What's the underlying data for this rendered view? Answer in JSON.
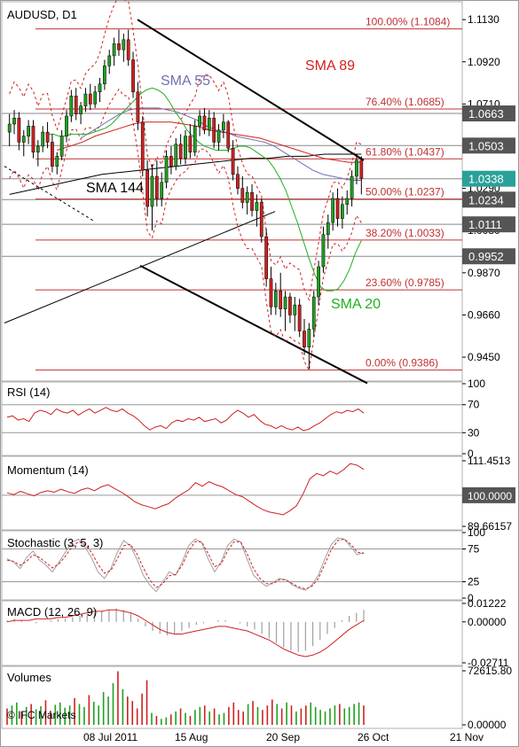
{
  "chart_data": [
    {
      "type": "candlestick",
      "title": "AUDUSD, D1",
      "ylim": [
        0.934,
        1.121
      ],
      "y_ticks": [
        "1.1130",
        "1.0920",
        "1.0710",
        "1.0290",
        "1.0080",
        "0.9870",
        "0.9660",
        "0.9450"
      ],
      "price_tags": [
        {
          "label": "1.0663",
          "value": 1.0663,
          "color": "#555555"
        },
        {
          "label": "1.0503",
          "value": 1.0503,
          "color": "#555555"
        },
        {
          "label": "1.0338",
          "value": 1.0338,
          "color": "#2aa198"
        },
        {
          "label": "1.0234",
          "value": 1.0234,
          "color": "#555555"
        },
        {
          "label": "1.0111",
          "value": 1.0111,
          "color": "#555555"
        },
        {
          "label": "0.9952",
          "value": 0.9952,
          "color": "#555555"
        }
      ],
      "fibonacci": [
        {
          "label": "100.00% (1.1084)",
          "value": 1.1084
        },
        {
          "label": "76.40% (1.0685)",
          "value": 1.0685
        },
        {
          "label": "61.80% (1.0437)",
          "value": 1.0437
        },
        {
          "label": "50.00% (1.0237)",
          "value": 1.0237
        },
        {
          "label": "38.20% (1.0033)",
          "value": 1.0033
        },
        {
          "label": "23.60% (0.9785)",
          "value": 0.9785
        },
        {
          "label": "0.00% (0.9386)",
          "value": 0.9386
        }
      ],
      "annotations": [
        {
          "text": "SMA 89",
          "color": "#d42020"
        },
        {
          "text": "SMA 55",
          "color": "#7070b0"
        },
        {
          "text": "SMA 144",
          "color": "#000000"
        },
        {
          "text": "SMA 20",
          "color": "#20b020"
        }
      ],
      "colors": {
        "bull": "#20a020",
        "bear": "#d02020",
        "fib": "#c03030"
      },
      "candles": [
        [
          1.057,
          1.066,
          1.05,
          1.061
        ],
        [
          1.061,
          1.068,
          1.056,
          1.064
        ],
        [
          1.064,
          1.067,
          1.048,
          1.052
        ],
        [
          1.052,
          1.058,
          1.045,
          1.055
        ],
        [
          1.055,
          1.063,
          1.051,
          1.06
        ],
        [
          1.06,
          1.063,
          1.044,
          1.047
        ],
        [
          1.047,
          1.053,
          1.04,
          1.05
        ],
        [
          1.05,
          1.06,
          1.047,
          1.057
        ],
        [
          1.057,
          1.062,
          1.049,
          1.052
        ],
        [
          1.052,
          1.056,
          1.037,
          1.04
        ],
        [
          1.04,
          1.047,
          1.036,
          1.045
        ],
        [
          1.045,
          1.058,
          1.043,
          1.055
        ],
        [
          1.055,
          1.068,
          1.052,
          1.065
        ],
        [
          1.065,
          1.078,
          1.062,
          1.075
        ],
        [
          1.075,
          1.079,
          1.063,
          1.066
        ],
        [
          1.066,
          1.072,
          1.061,
          1.07
        ],
        [
          1.07,
          1.079,
          1.067,
          1.076
        ],
        [
          1.076,
          1.081,
          1.068,
          1.071
        ],
        [
          1.071,
          1.08,
          1.069,
          1.077
        ],
        [
          1.077,
          1.084,
          1.072,
          1.081
        ],
        [
          1.081,
          1.093,
          1.078,
          1.09
        ],
        [
          1.09,
          1.098,
          1.086,
          1.095
        ],
        [
          1.095,
          1.104,
          1.09,
          1.101
        ],
        [
          1.101,
          1.108,
          1.095,
          1.098
        ],
        [
          1.098,
          1.106,
          1.092,
          1.103
        ],
        [
          1.103,
          1.108,
          1.09,
          1.093
        ],
        [
          1.093,
          1.097,
          1.074,
          1.077
        ],
        [
          1.077,
          1.082,
          1.058,
          1.062
        ],
        [
          1.062,
          1.065,
          1.035,
          1.038
        ],
        [
          1.038,
          1.043,
          1.015,
          1.02
        ],
        [
          1.02,
          1.041,
          1.008,
          1.035
        ],
        [
          1.035,
          1.043,
          1.02,
          1.024
        ],
        [
          1.024,
          1.037,
          1.02,
          1.032
        ],
        [
          1.032,
          1.048,
          1.029,
          1.045
        ],
        [
          1.045,
          1.05,
          1.036,
          1.04
        ],
        [
          1.04,
          1.054,
          1.038,
          1.051
        ],
        [
          1.051,
          1.056,
          1.041,
          1.044
        ],
        [
          1.044,
          1.058,
          1.041,
          1.055
        ],
        [
          1.055,
          1.061,
          1.044,
          1.047
        ],
        [
          1.047,
          1.063,
          1.045,
          1.06
        ],
        [
          1.06,
          1.068,
          1.055,
          1.065
        ],
        [
          1.065,
          1.069,
          1.056,
          1.058
        ],
        [
          1.058,
          1.068,
          1.055,
          1.064
        ],
        [
          1.064,
          1.067,
          1.049,
          1.052
        ],
        [
          1.052,
          1.061,
          1.048,
          1.058
        ],
        [
          1.058,
          1.066,
          1.054,
          1.062
        ],
        [
          1.062,
          1.063,
          1.047,
          1.049
        ],
        [
          1.049,
          1.053,
          1.033,
          1.036
        ],
        [
          1.036,
          1.04,
          1.026,
          1.029
        ],
        [
          1.029,
          1.035,
          1.019,
          1.022
        ],
        [
          1.022,
          1.03,
          1.016,
          1.027
        ],
        [
          1.027,
          1.031,
          1.015,
          1.018
        ],
        [
          1.018,
          1.026,
          1.01,
          1.022
        ],
        [
          1.022,
          1.024,
          1.002,
          1.005
        ],
        [
          1.005,
          1.009,
          0.98,
          0.984
        ],
        [
          0.984,
          0.99,
          0.966,
          0.97
        ],
        [
          0.97,
          0.982,
          0.966,
          0.978
        ],
        [
          0.978,
          0.987,
          0.965,
          0.969
        ],
        [
          0.969,
          0.978,
          0.958,
          0.975
        ],
        [
          0.975,
          0.977,
          0.962,
          0.966
        ],
        [
          0.966,
          0.975,
          0.958,
          0.971
        ],
        [
          0.971,
          0.974,
          0.955,
          0.958
        ],
        [
          0.958,
          0.964,
          0.946,
          0.95
        ],
        [
          0.95,
          0.962,
          0.939,
          0.959
        ],
        [
          0.959,
          0.978,
          0.955,
          0.975
        ],
        [
          0.975,
          0.993,
          0.971,
          0.99
        ],
        [
          0.99,
          1.01,
          0.987,
          1.006
        ],
        [
          1.006,
          1.016,
          0.999,
          1.012
        ],
        [
          1.012,
          1.027,
          1.008,
          1.024
        ],
        [
          1.024,
          1.029,
          1.01,
          1.014
        ],
        [
          1.014,
          1.025,
          1.009,
          1.021
        ],
        [
          1.021,
          1.028,
          1.016,
          1.024
        ],
        [
          1.024,
          1.038,
          1.02,
          1.035
        ],
        [
          1.035,
          1.046,
          1.031,
          1.043
        ],
        [
          1.043,
          1.045,
          1.026,
          1.034
        ]
      ],
      "sma20": [
        1.056,
        1.056,
        1.055,
        1.055,
        1.056,
        1.056,
        1.056,
        1.056,
        1.057,
        1.058,
        1.059,
        1.061,
        1.064,
        1.067,
        1.07,
        1.073,
        1.076,
        1.078,
        1.079,
        1.078,
        1.076,
        1.072,
        1.067,
        1.063,
        1.058,
        1.055,
        1.052,
        1.05,
        1.049,
        1.048,
        1.048,
        1.048,
        1.049,
        1.05,
        1.05,
        1.049,
        1.047,
        1.045,
        1.043,
        1.039,
        1.034,
        1.028,
        1.02,
        1.012,
        1.003,
        0.994,
        0.986,
        0.98,
        0.978,
        0.978,
        0.979,
        0.983,
        0.989,
        0.997,
        1.003
      ],
      "sma55": [
        1.054,
        1.057,
        1.06,
        1.063,
        1.066,
        1.068,
        1.069,
        1.069,
        1.069,
        1.068,
        1.067,
        1.065,
        1.063,
        1.06,
        1.058,
        1.057,
        1.055,
        1.054,
        1.053,
        1.052,
        1.05,
        1.047,
        1.044,
        1.041,
        1.038,
        1.036,
        1.035,
        1.034,
        1.033,
        1.033
      ],
      "sma89": [
        1.048,
        1.05,
        1.052,
        1.055,
        1.057,
        1.059,
        1.061,
        1.062,
        1.062,
        1.062,
        1.061,
        1.06,
        1.058,
        1.057,
        1.056,
        1.055,
        1.054,
        1.052,
        1.05,
        1.048,
        1.046,
        1.044,
        1.043,
        1.042,
        1.042
      ],
      "sma144": [
        1.026,
        1.028,
        1.03,
        1.032,
        1.034,
        1.036,
        1.037,
        1.038,
        1.039,
        1.04,
        1.041,
        1.042,
        1.043,
        1.044,
        1.044,
        1.045,
        1.045,
        1.046,
        1.046,
        1.046
      ]
    },
    {
      "type": "line",
      "title": "RSI (14)",
      "ylim": [
        0,
        100
      ],
      "y_ticks": [
        "100",
        "70",
        "30",
        "0"
      ],
      "levels": [
        70,
        30
      ],
      "values": [
        52,
        54,
        48,
        50,
        46,
        58,
        62,
        60,
        56,
        64,
        60,
        58,
        62,
        55,
        60,
        64,
        58,
        62,
        66,
        62,
        60,
        64,
        58,
        54,
        48,
        40,
        34,
        38,
        40,
        36,
        44,
        48,
        46,
        50,
        48,
        52,
        46,
        48,
        50,
        44,
        48,
        56,
        62,
        58,
        52,
        56,
        48,
        42,
        40,
        36,
        40,
        36,
        34,
        38,
        33,
        35,
        40,
        44,
        50,
        56,
        60,
        58,
        62,
        60,
        64,
        58
      ]
    },
    {
      "type": "line",
      "title": "Momentum (14)",
      "y_ticks": [
        "111.4513",
        "100.0000",
        "89.66157"
      ],
      "ylim": [
        89.66157,
        111.4513
      ],
      "values": [
        100.8,
        100.2,
        101.3,
        100.5,
        99.8,
        100.9,
        101.5,
        101.0,
        102.0,
        101.2,
        100.6,
        101.8,
        102.4,
        101.5,
        102.8,
        103.5,
        102.2,
        101.0,
        99.5,
        97.8,
        96.8,
        96.2,
        95.5,
        96.4,
        97.2,
        99.0,
        100.5,
        101.8,
        104.2,
        103.0,
        104.5,
        103.5,
        102.8,
        101.5,
        100.2,
        99.5,
        98.0,
        96.5,
        95.2,
        94.4,
        94.0,
        93.5,
        94.8,
        96.5,
        100.5,
        105.5,
        107.2,
        106.5,
        108.0,
        107.0,
        108.5,
        110.5,
        110.0,
        108.6
      ]
    },
    {
      "type": "line",
      "title": "Stochastic (3, 5, 3)",
      "ylim": [
        0,
        100
      ],
      "y_ticks": [
        "100",
        "75",
        "25",
        "0"
      ],
      "levels": [
        75,
        25
      ],
      "series": [
        {
          "values": [
            60,
            55,
            45,
            62,
            72,
            58,
            50,
            40,
            55,
            70,
            85,
            90,
            78,
            62,
            40,
            30,
            45,
            70,
            88,
            80,
            60,
            35,
            20,
            10,
            25,
            40,
            35,
            55,
            80,
            90,
            85,
            60,
            40,
            55,
            80,
            90,
            86,
            60,
            35,
            25,
            18,
            24,
            30,
            28,
            20,
            15,
            12,
            20,
            35,
            60,
            82,
            92,
            90,
            78,
            66,
            70
          ]
        },
        {
          "values": [
            58,
            56,
            50,
            56,
            66,
            62,
            54,
            46,
            52,
            64,
            78,
            86,
            82,
            70,
            52,
            38,
            42,
            60,
            80,
            82,
            68,
            46,
            28,
            16,
            22,
            34,
            36,
            50,
            72,
            86,
            86,
            68,
            48,
            52,
            72,
            86,
            86,
            68,
            45,
            30,
            22,
            22,
            28,
            28,
            22,
            17,
            14,
            18,
            30,
            52,
            74,
            88,
            90,
            82,
            70,
            68
          ]
        }
      ]
    },
    {
      "type": "histogram-line",
      "title": "MACD (12, 26, 9)",
      "y_ticks": [
        "0.01222",
        "0.00000",
        "-0.02711"
      ],
      "ylim": [
        -0.02711,
        0.01222
      ],
      "histogram": [
        0.001,
        0.002,
        0.001,
        0.0,
        -0.001,
        0.0,
        0.001,
        0.002,
        0.002,
        0.003,
        0.004,
        0.005,
        0.006,
        0.007,
        0.008,
        0.009,
        0.008,
        0.006,
        0.002,
        -0.003,
        -0.006,
        -0.008,
        -0.009,
        -0.008,
        -0.006,
        -0.004,
        -0.002,
        -0.001,
        0.0,
        0.001,
        0.001,
        0.0,
        -0.001,
        -0.003,
        -0.005,
        -0.008,
        -0.011,
        -0.014,
        -0.017,
        -0.019,
        -0.02,
        -0.019,
        -0.016,
        -0.012,
        -0.008,
        -0.004,
        0.001,
        0.004,
        0.006,
        0.008
      ],
      "signal": [
        0.0,
        0.001,
        0.001,
        0.001,
        0.002,
        0.002,
        0.002,
        0.003,
        0.003,
        0.004,
        0.005,
        0.006,
        0.007,
        0.007,
        0.008,
        0.008,
        0.007,
        0.006,
        0.004,
        0.001,
        -0.002,
        -0.005,
        -0.007,
        -0.008,
        -0.008,
        -0.007,
        -0.006,
        -0.005,
        -0.004,
        -0.003,
        -0.003,
        -0.004,
        -0.005,
        -0.006,
        -0.008,
        -0.01,
        -0.012,
        -0.015,
        -0.018,
        -0.02,
        -0.022,
        -0.023,
        -0.022,
        -0.02,
        -0.017,
        -0.013,
        -0.009,
        -0.005,
        -0.002,
        0.001
      ]
    },
    {
      "type": "bar",
      "title": "Volumes",
      "y_ticks": [
        "72615.80",
        "0.00000"
      ],
      "ylim": [
        0,
        72615.8
      ],
      "watermark": "© IFC Markets",
      "values": [
        22000,
        26000,
        30000,
        18000,
        24000,
        28000,
        21000,
        25000,
        33000,
        19000,
        27000,
        30000,
        23000,
        26000,
        36000,
        28000,
        24000,
        40000,
        31000,
        26000,
        44000,
        38000,
        56000,
        72000,
        48000,
        38000,
        32000,
        22000,
        42000,
        60000,
        16000,
        12000,
        8000,
        10000,
        14000,
        18000,
        22000,
        16000,
        12000,
        20000,
        24000,
        26000,
        18000,
        22000,
        14000,
        16000,
        24000,
        30000,
        20000,
        18000,
        28000,
        32000,
        24000,
        20000,
        26000,
        34000,
        28000,
        22000,
        30000,
        26000,
        18000,
        22000,
        26000,
        30000,
        24000,
        20000,
        18000,
        22000,
        26000,
        28000,
        22000,
        24000,
        28000,
        30000,
        26000
      ],
      "colors": [
        "#d02020",
        "#20a020",
        "#20a020",
        "#d02020",
        "#20a020",
        "#d02020",
        "#20a020",
        "#20a020",
        "#d02020",
        "#d02020",
        "#20a020",
        "#20a020",
        "#20a020",
        "#20a020",
        "#d02020",
        "#20a020",
        "#20a020",
        "#d02020",
        "#20a020",
        "#20a020",
        "#20a020",
        "#20a020",
        "#20a020",
        "#d02020",
        "#20a020",
        "#d02020",
        "#d02020",
        "#d02020",
        "#d02020",
        "#d02020",
        "#20a020",
        "#d02020",
        "#20a020",
        "#20a020",
        "#d02020",
        "#20a020",
        "#d02020",
        "#20a020",
        "#d02020",
        "#20a020",
        "#20a020",
        "#d02020",
        "#20a020",
        "#d02020",
        "#20a020",
        "#20a020",
        "#d02020",
        "#d02020",
        "#d02020",
        "#d02020",
        "#20a020",
        "#d02020",
        "#20a020",
        "#d02020",
        "#d02020",
        "#d02020",
        "#20a020",
        "#d02020",
        "#20a020",
        "#d02020",
        "#20a020",
        "#d02020",
        "#d02020",
        "#20a020",
        "#20a020",
        "#20a020",
        "#20a020",
        "#20a020",
        "#20a020",
        "#d02020",
        "#20a020",
        "#20a020",
        "#20a020",
        "#20a020",
        "#d02020"
      ]
    }
  ],
  "x_axis": {
    "labels": [
      "08 Jul 2011",
      "15 Aug",
      "20 Sep",
      "26 Oct",
      "21 Nov"
    ]
  }
}
